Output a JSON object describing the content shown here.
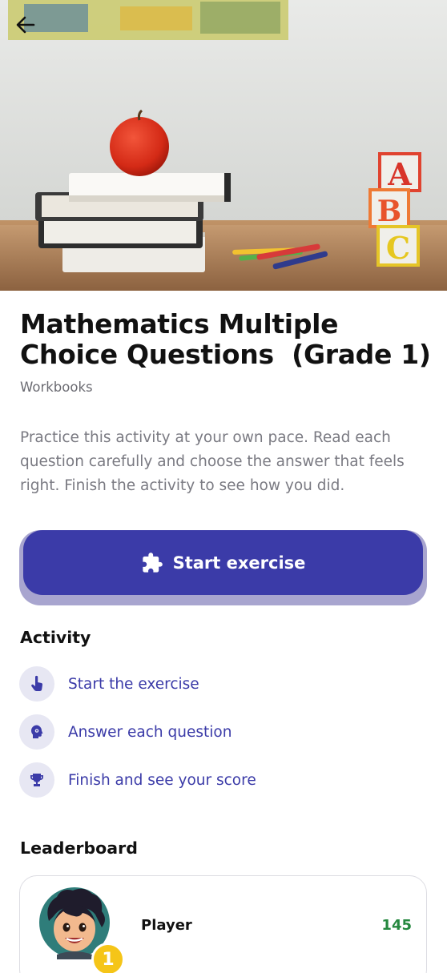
{
  "header": {
    "back_icon": "arrow-left-icon",
    "hero_image": "stack-of-books-with-apple-pencils-abc-blocks"
  },
  "exercise": {
    "title": "Mathematics Multiple Choice Questions  (Grade 1)",
    "category": "Workbooks",
    "description": "Practice this activity at your own pace. Read each question carefully and choose the answer that feels right. Finish the activity to see how you did.",
    "start_button": {
      "label": "Start exercise",
      "icon": "puzzle-piece-icon"
    }
  },
  "activity": {
    "title": "Activity",
    "items": [
      {
        "label": "Start the exercise",
        "icon": "tap-hand-icon"
      },
      {
        "label": "Answer each question",
        "icon": "brain-head-icon"
      },
      {
        "label": "Finish and see your score",
        "icon": "trophy-icon"
      }
    ]
  },
  "leaderboard": {
    "title": "Leaderboard",
    "entries": [
      {
        "rank": "1",
        "name": "Player",
        "score": "145"
      }
    ]
  },
  "colors": {
    "primary": "#3b3ba8",
    "button_shadow": "#a8a5cf",
    "score_green": "#25883f",
    "badge_gold": "#f5c518"
  }
}
